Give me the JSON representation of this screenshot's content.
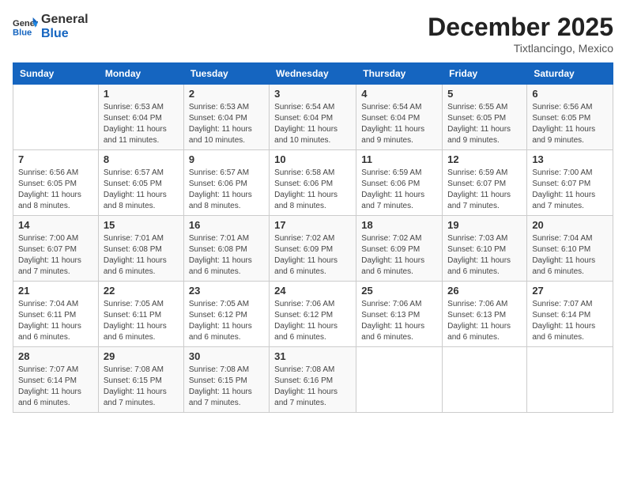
{
  "header": {
    "logo_line1": "General",
    "logo_line2": "Blue",
    "title": "December 2025",
    "subtitle": "Tixtlancingo, Mexico"
  },
  "columns": [
    "Sunday",
    "Monday",
    "Tuesday",
    "Wednesday",
    "Thursday",
    "Friday",
    "Saturday"
  ],
  "weeks": [
    [
      {
        "day": "",
        "sunrise": "",
        "sunset": "",
        "daylight": ""
      },
      {
        "day": "1",
        "sunrise": "Sunrise: 6:53 AM",
        "sunset": "Sunset: 6:04 PM",
        "daylight": "Daylight: 11 hours and 11 minutes."
      },
      {
        "day": "2",
        "sunrise": "Sunrise: 6:53 AM",
        "sunset": "Sunset: 6:04 PM",
        "daylight": "Daylight: 11 hours and 10 minutes."
      },
      {
        "day": "3",
        "sunrise": "Sunrise: 6:54 AM",
        "sunset": "Sunset: 6:04 PM",
        "daylight": "Daylight: 11 hours and 10 minutes."
      },
      {
        "day": "4",
        "sunrise": "Sunrise: 6:54 AM",
        "sunset": "Sunset: 6:04 PM",
        "daylight": "Daylight: 11 hours and 9 minutes."
      },
      {
        "day": "5",
        "sunrise": "Sunrise: 6:55 AM",
        "sunset": "Sunset: 6:05 PM",
        "daylight": "Daylight: 11 hours and 9 minutes."
      },
      {
        "day": "6",
        "sunrise": "Sunrise: 6:56 AM",
        "sunset": "Sunset: 6:05 PM",
        "daylight": "Daylight: 11 hours and 9 minutes."
      }
    ],
    [
      {
        "day": "7",
        "sunrise": "Sunrise: 6:56 AM",
        "sunset": "Sunset: 6:05 PM",
        "daylight": "Daylight: 11 hours and 8 minutes."
      },
      {
        "day": "8",
        "sunrise": "Sunrise: 6:57 AM",
        "sunset": "Sunset: 6:05 PM",
        "daylight": "Daylight: 11 hours and 8 minutes."
      },
      {
        "day": "9",
        "sunrise": "Sunrise: 6:57 AM",
        "sunset": "Sunset: 6:06 PM",
        "daylight": "Daylight: 11 hours and 8 minutes."
      },
      {
        "day": "10",
        "sunrise": "Sunrise: 6:58 AM",
        "sunset": "Sunset: 6:06 PM",
        "daylight": "Daylight: 11 hours and 8 minutes."
      },
      {
        "day": "11",
        "sunrise": "Sunrise: 6:59 AM",
        "sunset": "Sunset: 6:06 PM",
        "daylight": "Daylight: 11 hours and 7 minutes."
      },
      {
        "day": "12",
        "sunrise": "Sunrise: 6:59 AM",
        "sunset": "Sunset: 6:07 PM",
        "daylight": "Daylight: 11 hours and 7 minutes."
      },
      {
        "day": "13",
        "sunrise": "Sunrise: 7:00 AM",
        "sunset": "Sunset: 6:07 PM",
        "daylight": "Daylight: 11 hours and 7 minutes."
      }
    ],
    [
      {
        "day": "14",
        "sunrise": "Sunrise: 7:00 AM",
        "sunset": "Sunset: 6:07 PM",
        "daylight": "Daylight: 11 hours and 7 minutes."
      },
      {
        "day": "15",
        "sunrise": "Sunrise: 7:01 AM",
        "sunset": "Sunset: 6:08 PM",
        "daylight": "Daylight: 11 hours and 6 minutes."
      },
      {
        "day": "16",
        "sunrise": "Sunrise: 7:01 AM",
        "sunset": "Sunset: 6:08 PM",
        "daylight": "Daylight: 11 hours and 6 minutes."
      },
      {
        "day": "17",
        "sunrise": "Sunrise: 7:02 AM",
        "sunset": "Sunset: 6:09 PM",
        "daylight": "Daylight: 11 hours and 6 minutes."
      },
      {
        "day": "18",
        "sunrise": "Sunrise: 7:02 AM",
        "sunset": "Sunset: 6:09 PM",
        "daylight": "Daylight: 11 hours and 6 minutes."
      },
      {
        "day": "19",
        "sunrise": "Sunrise: 7:03 AM",
        "sunset": "Sunset: 6:10 PM",
        "daylight": "Daylight: 11 hours and 6 minutes."
      },
      {
        "day": "20",
        "sunrise": "Sunrise: 7:04 AM",
        "sunset": "Sunset: 6:10 PM",
        "daylight": "Daylight: 11 hours and 6 minutes."
      }
    ],
    [
      {
        "day": "21",
        "sunrise": "Sunrise: 7:04 AM",
        "sunset": "Sunset: 6:11 PM",
        "daylight": "Daylight: 11 hours and 6 minutes."
      },
      {
        "day": "22",
        "sunrise": "Sunrise: 7:05 AM",
        "sunset": "Sunset: 6:11 PM",
        "daylight": "Daylight: 11 hours and 6 minutes."
      },
      {
        "day": "23",
        "sunrise": "Sunrise: 7:05 AM",
        "sunset": "Sunset: 6:12 PM",
        "daylight": "Daylight: 11 hours and 6 minutes."
      },
      {
        "day": "24",
        "sunrise": "Sunrise: 7:06 AM",
        "sunset": "Sunset: 6:12 PM",
        "daylight": "Daylight: 11 hours and 6 minutes."
      },
      {
        "day": "25",
        "sunrise": "Sunrise: 7:06 AM",
        "sunset": "Sunset: 6:13 PM",
        "daylight": "Daylight: 11 hours and 6 minutes."
      },
      {
        "day": "26",
        "sunrise": "Sunrise: 7:06 AM",
        "sunset": "Sunset: 6:13 PM",
        "daylight": "Daylight: 11 hours and 6 minutes."
      },
      {
        "day": "27",
        "sunrise": "Sunrise: 7:07 AM",
        "sunset": "Sunset: 6:14 PM",
        "daylight": "Daylight: 11 hours and 6 minutes."
      }
    ],
    [
      {
        "day": "28",
        "sunrise": "Sunrise: 7:07 AM",
        "sunset": "Sunset: 6:14 PM",
        "daylight": "Daylight: 11 hours and 6 minutes."
      },
      {
        "day": "29",
        "sunrise": "Sunrise: 7:08 AM",
        "sunset": "Sunset: 6:15 PM",
        "daylight": "Daylight: 11 hours and 7 minutes."
      },
      {
        "day": "30",
        "sunrise": "Sunrise: 7:08 AM",
        "sunset": "Sunset: 6:15 PM",
        "daylight": "Daylight: 11 hours and 7 minutes."
      },
      {
        "day": "31",
        "sunrise": "Sunrise: 7:08 AM",
        "sunset": "Sunset: 6:16 PM",
        "daylight": "Daylight: 11 hours and 7 minutes."
      },
      {
        "day": "",
        "sunrise": "",
        "sunset": "",
        "daylight": ""
      },
      {
        "day": "",
        "sunrise": "",
        "sunset": "",
        "daylight": ""
      },
      {
        "day": "",
        "sunrise": "",
        "sunset": "",
        "daylight": ""
      }
    ]
  ]
}
